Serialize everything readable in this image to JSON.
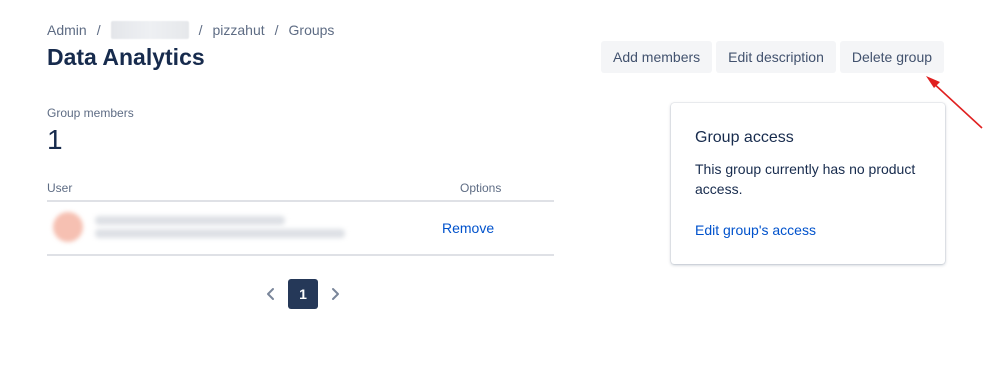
{
  "breadcrumb": {
    "items": [
      "Admin",
      "",
      "pizzahut",
      "Groups"
    ],
    "separator": "/"
  },
  "page": {
    "title": "Data Analytics"
  },
  "actions": {
    "add_members": "Add members",
    "edit_description": "Edit description",
    "delete_group": "Delete group"
  },
  "members": {
    "label": "Group members",
    "count": "1"
  },
  "table": {
    "headers": {
      "user": "User",
      "options": "Options"
    },
    "rows": [
      {
        "remove_label": "Remove"
      }
    ]
  },
  "pagination": {
    "current": "1"
  },
  "access": {
    "title": "Group access",
    "text": "This group currently has no product access.",
    "link": "Edit group's access"
  },
  "colors": {
    "primary_text": "#172b4d",
    "link": "#0052cc",
    "button_bg": "#f4f5f7",
    "page_current_bg": "#253858",
    "annotation_arrow": "#e02020"
  }
}
